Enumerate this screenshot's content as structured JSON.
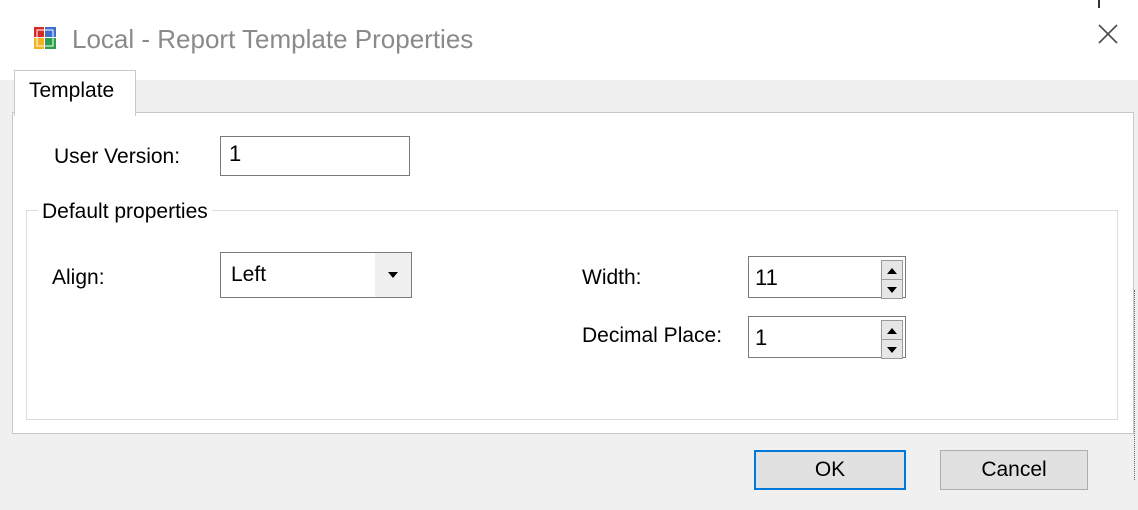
{
  "window": {
    "title": "Local - Report Template Properties"
  },
  "tabs": [
    {
      "label": "Template"
    }
  ],
  "form": {
    "user_version": {
      "label": "User Version:",
      "value": "1"
    },
    "default_properties": {
      "title": "Default properties",
      "align": {
        "label": "Align:",
        "value": "Left"
      },
      "width": {
        "label": "Width:",
        "value": "11"
      },
      "decimal_place": {
        "label": "Decimal Place:",
        "value": "1"
      }
    }
  },
  "buttons": {
    "ok": "OK",
    "cancel": "Cancel"
  },
  "icons": {
    "app": "app-window-icon",
    "close": "close-icon",
    "dropdown": "chevron-down-icon",
    "spin_up": "spin-up-arrow-icon",
    "spin_down": "spin-down-arrow-icon"
  },
  "colors": {
    "accent": "#0078d7",
    "title_text": "#8a8a8a"
  }
}
